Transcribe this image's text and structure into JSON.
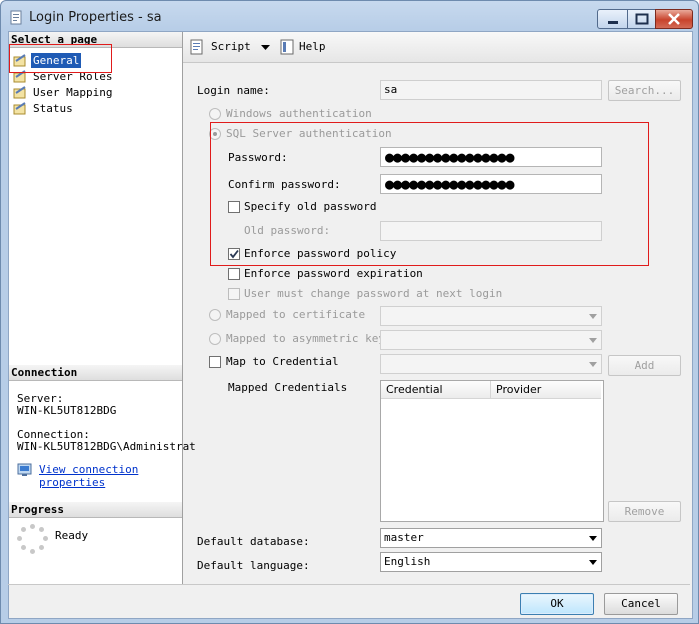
{
  "window": {
    "title": "Login Properties - sa"
  },
  "left": {
    "select_page_header": "Select a page",
    "pages": [
      {
        "label": "General"
      },
      {
        "label": "Server Roles"
      },
      {
        "label": "User Mapping"
      },
      {
        "label": "Status"
      }
    ],
    "connection_header": "Connection",
    "server_label": "Server:",
    "server_value": "WIN-KL5UT812BDG",
    "connection_label": "Connection:",
    "connection_value": "WIN-KL5UT812BDG\\Administrat",
    "view_connection_line1": "View connection",
    "view_connection_line2": "properties",
    "progress_header": "Progress",
    "progress_status": "Ready"
  },
  "toolbar": {
    "script_label": "Script",
    "help_label": "Help"
  },
  "form": {
    "login_name_label": "Login name:",
    "login_name_value": "sa",
    "search_button": "Search...",
    "windows_auth_label": "Windows authentication",
    "sql_auth_label": "SQL Server authentication",
    "password_label": "Password:",
    "password_mask": "●●●●●●●●●●●●●●●●",
    "confirm_password_label": "Confirm password:",
    "confirm_password_mask": "●●●●●●●●●●●●●●●●",
    "specify_old_password_label": "Specify old password",
    "old_password_label": "Old password:",
    "enforce_policy_label": "Enforce password policy",
    "enforce_policy_checked": true,
    "enforce_expiration_label": "Enforce password expiration",
    "must_change_label": "User must change password at next login",
    "mapped_certificate_label": "Mapped to certificate",
    "mapped_asym_key_label": "Mapped to asymmetric key",
    "map_credential_label": "Map to Credential",
    "add_button": "Add",
    "mapped_credentials_label": "Mapped Credentials",
    "grid_columns": [
      "Credential",
      "Provider"
    ],
    "remove_button": "Remove",
    "default_database_label": "Default database:",
    "default_database_value": "master",
    "default_language_label": "Default language:",
    "default_language_value": "English"
  },
  "buttons": {
    "ok": "OK",
    "cancel": "Cancel"
  }
}
